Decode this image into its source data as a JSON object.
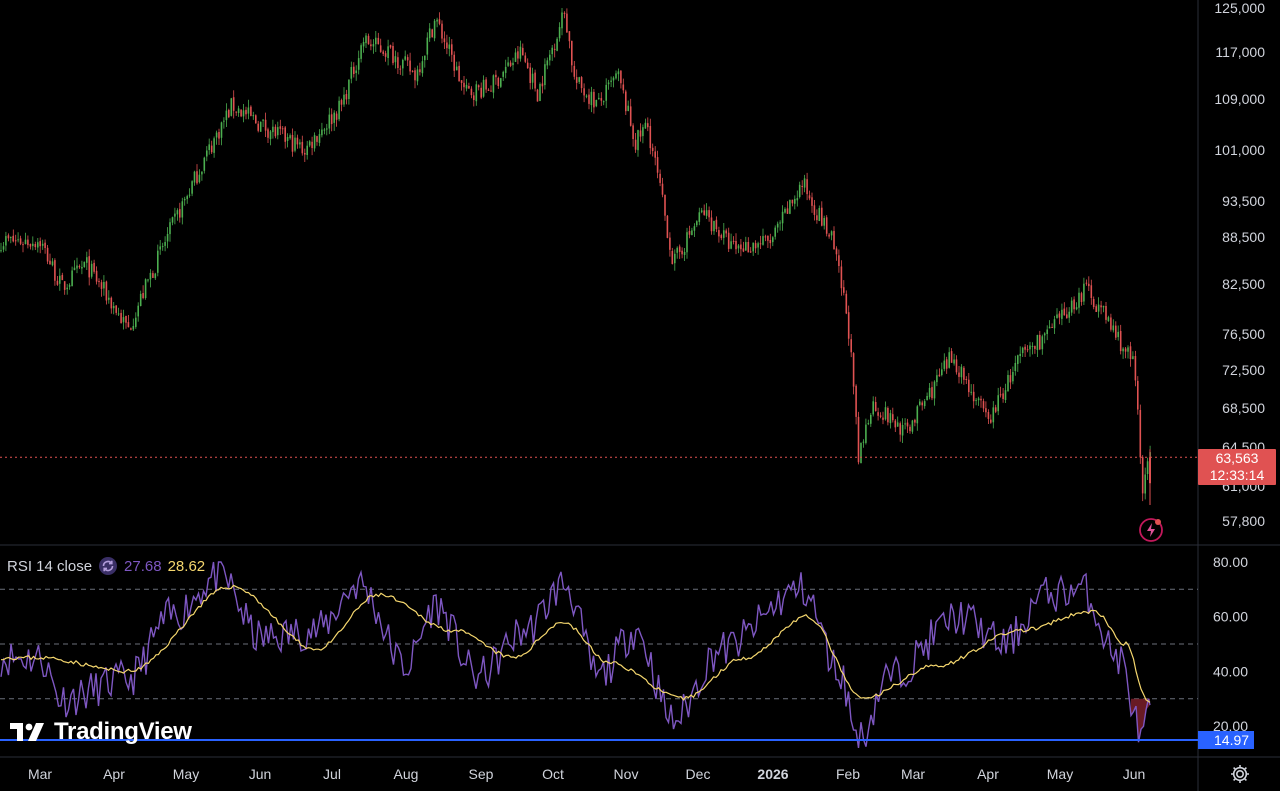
{
  "colors": {
    "background": "#000000",
    "up": "#4caf50",
    "down": "#e05252",
    "rsi_line": "#7e57c2",
    "rsi_ma": "#f5d76e",
    "price_label_bg": "#e05252",
    "rsi_label_bg": "#2962ff"
  },
  "price_axis": {
    "ticks": [
      "125,000",
      "117,000",
      "109,000",
      "101,000",
      "93,500",
      "88,500",
      "82,500",
      "76,500",
      "72,500",
      "68,500",
      "64,500",
      "61,000",
      "57,800"
    ],
    "current_price": "63,563",
    "countdown": "12:33:14"
  },
  "rsi_axis": {
    "ticks": [
      "80.00",
      "60.00",
      "40.00",
      "20.00"
    ],
    "current_label": "14.97"
  },
  "rsi_legend": {
    "label": "RSI 14 close",
    "rsi_value": "27.68",
    "ma_value": "28.62"
  },
  "time_axis": {
    "labels": [
      "Mar",
      "Apr",
      "May",
      "Jun",
      "Jul",
      "Aug",
      "Sep",
      "Oct",
      "Nov",
      "Dec",
      "2026",
      "Feb",
      "Mar",
      "Apr",
      "May",
      "Jun"
    ],
    "bold_label": "2026"
  },
  "watermark": {
    "text": "TradingView"
  },
  "icons": {
    "settings": "gear-icon",
    "alert": "flash-alert-icon",
    "sync": "sync-icon",
    "logo": "tradingview-logo-icon"
  },
  "chart_data": [
    {
      "type": "candlestick",
      "title": "",
      "x_range": [
        "Mar",
        "Jun"
      ],
      "y_range": [
        57800,
        125000
      ],
      "y_scale": "log",
      "grid": false,
      "anchors": [
        {
          "x": "Mar 1",
          "y": 88000
        },
        {
          "x": "Mar 10",
          "y": 82000
        },
        {
          "x": "Mar 20",
          "y": 85000
        },
        {
          "x": "Apr 7",
          "y": 77000
        },
        {
          "x": "Apr 20",
          "y": 86000
        },
        {
          "x": "May 1",
          "y": 94000
        },
        {
          "x": "May 20",
          "y": 108000
        },
        {
          "x": "Jun 1",
          "y": 105000
        },
        {
          "x": "Jun 20",
          "y": 101000
        },
        {
          "x": "Jul 5",
          "y": 108000
        },
        {
          "x": "Jul 14",
          "y": 119000
        },
        {
          "x": "Jul 25",
          "y": 117000
        },
        {
          "x": "Aug 5",
          "y": 113000
        },
        {
          "x": "Aug 13",
          "y": 123000
        },
        {
          "x": "Aug 25",
          "y": 110000
        },
        {
          "x": "Sep 5",
          "y": 111000
        },
        {
          "x": "Sep 18",
          "y": 117000
        },
        {
          "x": "Sep 25",
          "y": 110000
        },
        {
          "x": "Oct 6",
          "y": 124500
        },
        {
          "x": "Oct 10",
          "y": 112000
        },
        {
          "x": "Oct 20",
          "y": 108000
        },
        {
          "x": "Oct 28",
          "y": 113000
        },
        {
          "x": "Nov 5",
          "y": 102000
        },
        {
          "x": "Nov 10",
          "y": 105000
        },
        {
          "x": "Nov 21",
          "y": 85000
        },
        {
          "x": "Dec 3",
          "y": 92000
        },
        {
          "x": "Dec 15",
          "y": 87000
        },
        {
          "x": "Dec 31",
          "y": 88000
        },
        {
          "x": "Jan 13",
          "y": 96000
        },
        {
          "x": "Jan 25",
          "y": 88000
        },
        {
          "x": "Feb 1",
          "y": 78000
        },
        {
          "x": "Feb 6",
          "y": 63000
        },
        {
          "x": "Feb 12",
          "y": 69000
        },
        {
          "x": "Feb 28",
          "y": 66000
        },
        {
          "x": "Mar 10",
          "y": 71000
        },
        {
          "x": "Mar 17",
          "y": 74000
        },
        {
          "x": "Apr 1",
          "y": 67000
        },
        {
          "x": "Apr 15",
          "y": 74000
        },
        {
          "x": "Apr 28",
          "y": 77000
        },
        {
          "x": "May 12",
          "y": 82000
        },
        {
          "x": "May 25",
          "y": 76000
        },
        {
          "x": "Jun 1",
          "y": 73000
        },
        {
          "x": "Jun 5",
          "y": 60000
        },
        {
          "x": "Jun 7",
          "y": 63563
        }
      ],
      "last_close": 63563
    },
    {
      "type": "line",
      "title": "RSI 14 close",
      "y_range": [
        10,
        85
      ],
      "reference_levels": [
        70,
        50,
        30
      ],
      "series": [
        {
          "name": "RSI 14 close",
          "anchors": [
            {
              "x": "Mar 1",
              "y": 45
            },
            {
              "x": "Mar 10",
              "y": 30
            },
            {
              "x": "Apr 7",
              "y": 37
            },
            {
              "x": "Apr 25",
              "y": 60
            },
            {
              "x": "May 15",
              "y": 75
            },
            {
              "x": "Jun 1",
              "y": 52
            },
            {
              "x": "Jun 25",
              "y": 55
            },
            {
              "x": "Jul 12",
              "y": 72
            },
            {
              "x": "Aug 1",
              "y": 42
            },
            {
              "x": "Aug 13",
              "y": 64
            },
            {
              "x": "Aug 30",
              "y": 38
            },
            {
              "x": "Sep 20",
              "y": 55
            },
            {
              "x": "Oct 6",
              "y": 72
            },
            {
              "x": "Oct 20",
              "y": 38
            },
            {
              "x": "Nov 5",
              "y": 55
            },
            {
              "x": "Nov 21",
              "y": 22
            },
            {
              "x": "Dec 10",
              "y": 48
            },
            {
              "x": "Jan 13",
              "y": 70
            },
            {
              "x": "Jan 28",
              "y": 40
            },
            {
              "x": "Feb 6",
              "y": 15
            },
            {
              "x": "Feb 20",
              "y": 38
            },
            {
              "x": "Mar 20",
              "y": 60
            },
            {
              "x": "Apr 8",
              "y": 50
            },
            {
              "x": "Apr 25",
              "y": 68
            },
            {
              "x": "May 10",
              "y": 70
            },
            {
              "x": "May 25",
              "y": 45
            },
            {
              "x": "Jun 5",
              "y": 15
            },
            {
              "x": "Jun 7",
              "y": 27.68
            }
          ]
        },
        {
          "name": "",
          "anchors": [
            {
              "x": "Mar 1",
              "y": 45
            },
            {
              "x": "Apr 7",
              "y": 40
            },
            {
              "x": "May 20",
              "y": 71
            },
            {
              "x": "Jun 25",
              "y": 48
            },
            {
              "x": "Jul 20",
              "y": 68
            },
            {
              "x": "Aug 20",
              "y": 55
            },
            {
              "x": "Sep 15",
              "y": 45
            },
            {
              "x": "Oct 5",
              "y": 58
            },
            {
              "x": "Oct 25",
              "y": 43
            },
            {
              "x": "Nov 25",
              "y": 30
            },
            {
              "x": "Dec 20",
              "y": 45
            },
            {
              "x": "Jan 15",
              "y": 60
            },
            {
              "x": "Feb 8",
              "y": 30
            },
            {
              "x": "Mar 10",
              "y": 42
            },
            {
              "x": "Apr 15",
              "y": 55
            },
            {
              "x": "May 15",
              "y": 62
            },
            {
              "x": "May 28",
              "y": 50
            },
            {
              "x": "Jun 7",
              "y": 28.62
            }
          ]
        }
      ],
      "last_values": {
        "rsi": 27.68,
        "ma": 28.62,
        "axis_label": 14.97
      }
    }
  ]
}
